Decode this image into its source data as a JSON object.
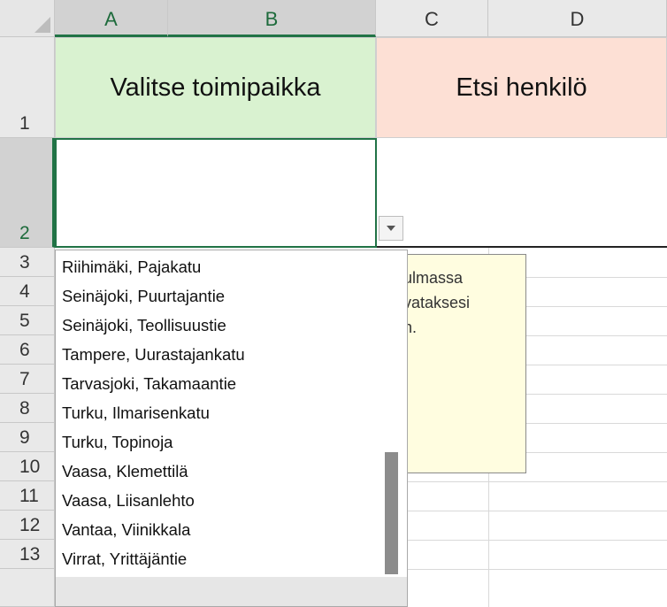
{
  "columns": [
    "A",
    "B",
    "C",
    "D"
  ],
  "rows": [
    "1",
    "2",
    "3",
    "4",
    "5",
    "6",
    "7",
    "8",
    "9",
    "10",
    "11",
    "12",
    "13"
  ],
  "cells": {
    "a1_header": "Valitse toimipaikka",
    "c1_header": "Etsi henkilö"
  },
  "comment": {
    "lines": [
      "ulmassa",
      "vataksesi",
      "n."
    ]
  },
  "dropdown": {
    "items": [
      "Riihimäki, Pajakatu",
      "Seinäjoki, Puurtajantie",
      "Seinäjoki, Teollisuustie",
      "Tampere, Uurastajankatu",
      "Tarvasjoki, Takamaantie",
      "Turku, Ilmarisenkatu",
      "Turku, Topinoja",
      "Vaasa, Klemettilä",
      "Vaasa, Liisanlehto",
      "Vantaa, Viinikkala",
      "Virrat, Yrittäjäntie"
    ],
    "button_icon": "chevron-down-icon"
  },
  "colors": {
    "header_green": "#d9f2d0",
    "header_salmon": "#fde0d5",
    "selection_green": "#217346",
    "comment_bg": "#fffde0"
  }
}
